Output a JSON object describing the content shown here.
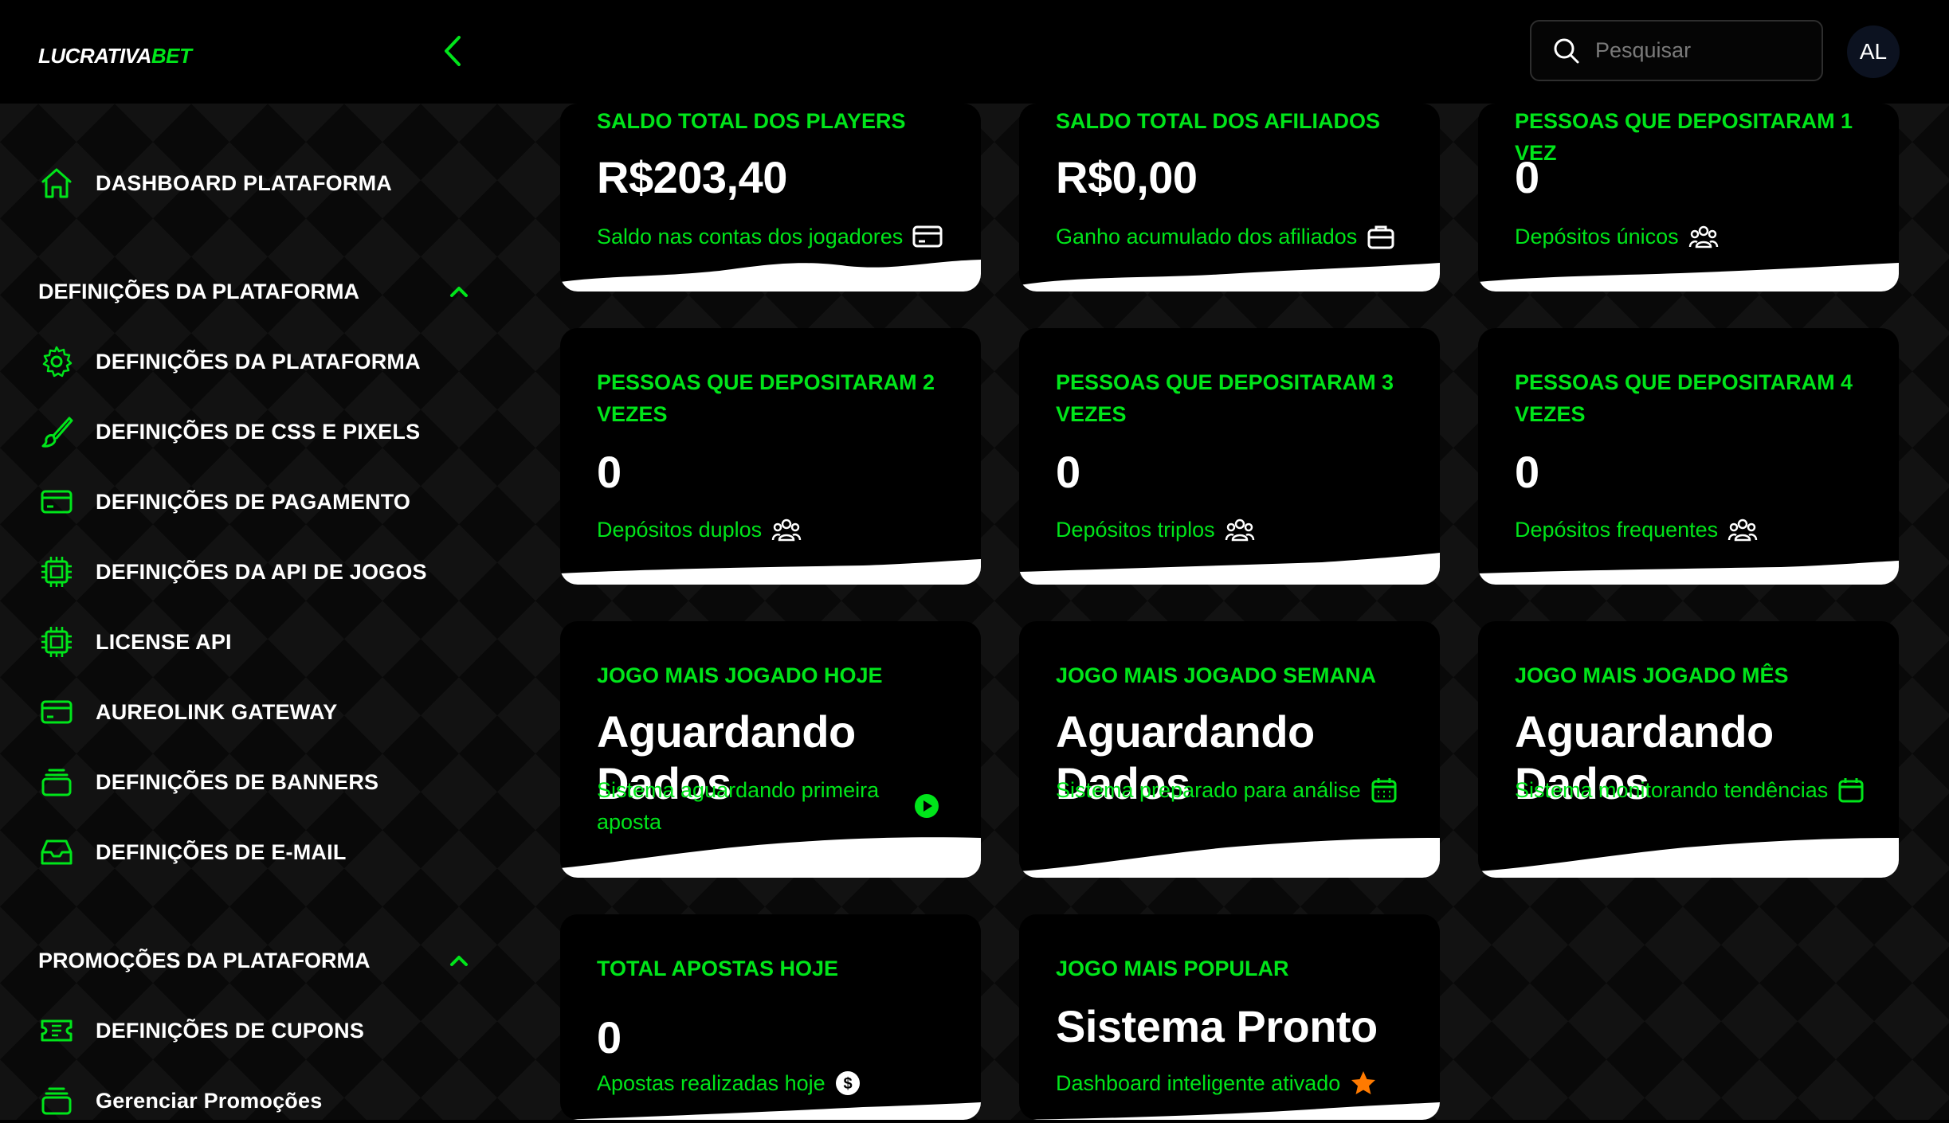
{
  "logo": {
    "part1": "LUCRATIVA",
    "part2": "BET"
  },
  "search": {
    "placeholder": "Pesquisar",
    "value": ""
  },
  "user": {
    "initials": "AL"
  },
  "sidebar": {
    "dashboard": {
      "label": "DASHBOARD PLATAFORMA",
      "icon": "home-icon"
    },
    "section1": {
      "label": "DEFINIÇÕES DA PLATAFORMA",
      "expanded": true
    },
    "items1": [
      {
        "label": "DEFINIÇÕES DA PLATAFORMA",
        "icon": "gear-icon"
      },
      {
        "label": "DEFINIÇÕES DE CSS E PIXELS",
        "icon": "brush-icon"
      },
      {
        "label": "DEFINIÇÕES DE PAGAMENTO",
        "icon": "credit-card-icon"
      },
      {
        "label": "DEFINIÇÕES DA API DE JOGOS",
        "icon": "chip-icon"
      },
      {
        "label": "LICENSE API",
        "icon": "chip-icon"
      },
      {
        "label": "AUREOLINK GATEWAY",
        "icon": "credit-card-icon"
      },
      {
        "label": "DEFINIÇÕES DE BANNERS",
        "icon": "stack-icon"
      },
      {
        "label": "DEFINIÇÕES DE E-MAIL",
        "icon": "inbox-icon"
      }
    ],
    "section2": {
      "label": "PROMOÇÕES DA PLATAFORMA",
      "expanded": true
    },
    "items2": [
      {
        "label": "DEFINIÇÕES DE CUPONS",
        "icon": "ticket-icon"
      },
      {
        "label": "Gerenciar Promoções",
        "icon": "stack-icon"
      }
    ]
  },
  "cards": [
    {
      "title": "SALDO TOTAL DOS PLAYERS",
      "value": "R$203,40",
      "sub": "Saldo nas contas dos jogadores",
      "icon": "credit-card-icon"
    },
    {
      "title": "SALDO TOTAL DOS AFILIADOS",
      "value": "R$0,00",
      "sub": "Ganho acumulado dos afiliados",
      "icon": "briefcase-icon"
    },
    {
      "title": "PESSOAS QUE DEPOSITARAM 1 VEZ",
      "value": "0",
      "sub": "Depósitos únicos",
      "icon": "users-icon"
    },
    {
      "title": "PESSOAS QUE DEPOSITARAM 2 VEZES",
      "value": "0",
      "sub": "Depósitos duplos",
      "icon": "users-icon"
    },
    {
      "title": "PESSOAS QUE DEPOSITARAM 3 VEZES",
      "value": "0",
      "sub": "Depósitos triplos",
      "icon": "users-icon"
    },
    {
      "title": "PESSOAS QUE DEPOSITARAM 4 VEZES",
      "value": "0",
      "sub": "Depósitos frequentes",
      "icon": "users-icon"
    },
    {
      "title": "JOGO MAIS JOGADO HOJE",
      "value": "Aguardando Dados",
      "sub": "Sistema aguardando primeira aposta",
      "icon": "play-circle-icon"
    },
    {
      "title": "JOGO MAIS JOGADO SEMANA",
      "value": "Aguardando Dados",
      "sub": "Sistema preparado para análise",
      "icon": "calendar-icon"
    },
    {
      "title": "JOGO MAIS JOGADO MÊS",
      "value": "Aguardando Dados",
      "sub": "Sistema monitorando tendências",
      "icon": "calendar-icon"
    },
    {
      "title": "TOTAL APOSTAS HOJE",
      "value": "0",
      "sub": "Apostas realizadas hoje",
      "icon": "dollar-icon"
    },
    {
      "title": "JOGO MAIS POPULAR",
      "value": "Sistema Pronto",
      "sub": "Dashboard inteligente ativado",
      "icon": "star-icon"
    }
  ],
  "colors": {
    "accent": "#00e51a",
    "star": "#ff7a00",
    "background": "#000000"
  }
}
